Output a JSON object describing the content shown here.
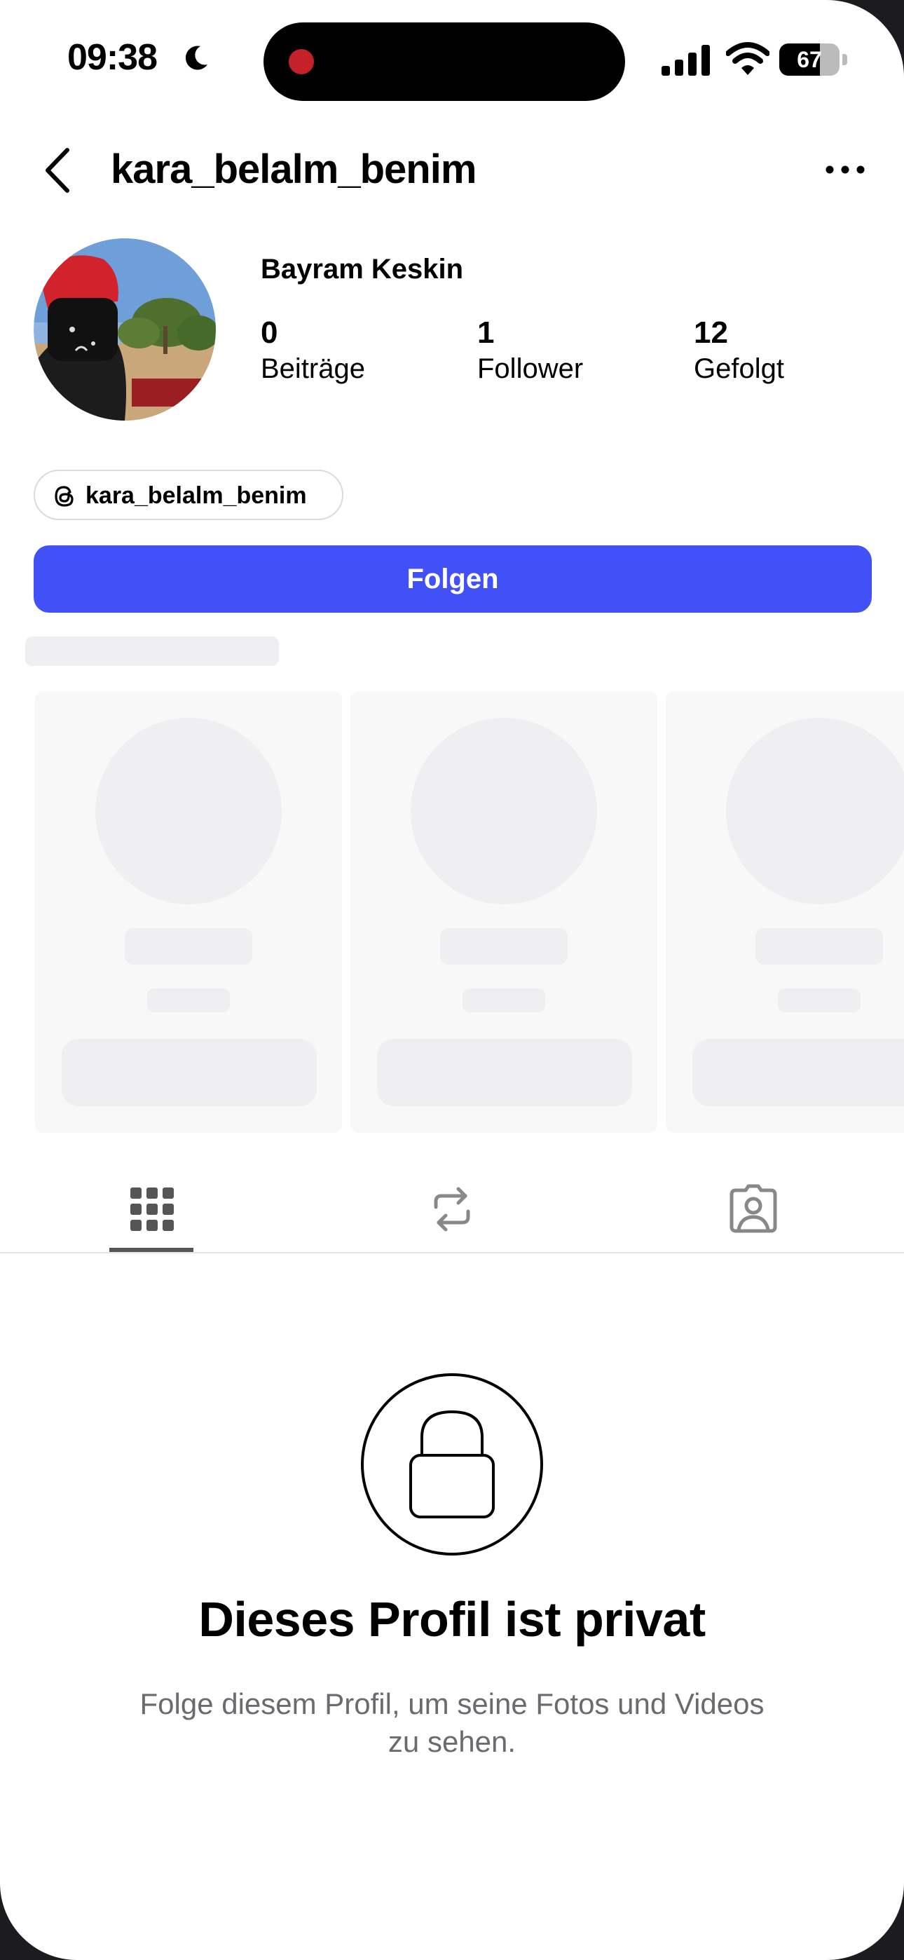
{
  "status_bar": {
    "time": "09:38",
    "battery_level": "67",
    "battery_fraction": 0.67
  },
  "header": {
    "username": "kara_belalm_benim",
    "back_icon": "chevron-left-icon",
    "more_icon": "ellipsis-icon"
  },
  "profile": {
    "display_name": "Bayram Keskin",
    "stats": [
      {
        "value": "0",
        "label": "Beiträge"
      },
      {
        "value": "1",
        "label": "Follower"
      },
      {
        "value": "12",
        "label": "Gefolgt"
      }
    ],
    "threads_handle": "kara_belalm_benim",
    "follow_label": "Folgen"
  },
  "tabs": [
    {
      "icon": "grid-icon",
      "active": true
    },
    {
      "icon": "repost-icon",
      "active": false
    },
    {
      "icon": "tagged-person-icon",
      "active": false
    }
  ],
  "private_notice": {
    "title": "Dieses Profil ist privat",
    "subtitle_line1": "Folge diesem Profil, um seine Fotos und Videos",
    "subtitle_line2": "zu sehen."
  },
  "colors": {
    "follow_button": "#4150f7",
    "recording_dot": "#c4212b"
  }
}
